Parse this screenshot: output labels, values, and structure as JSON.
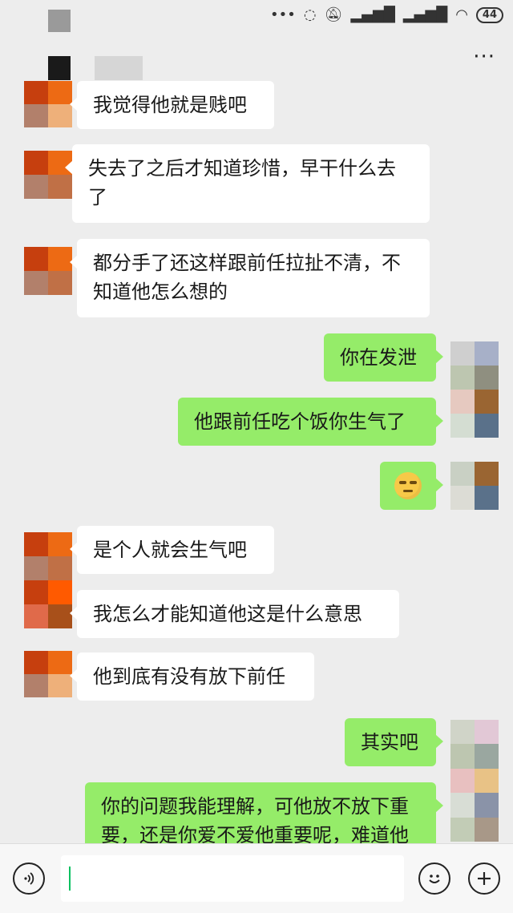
{
  "status_bar": {
    "battery": "44"
  },
  "header": {
    "more": "···"
  },
  "messages": [
    {
      "dir": "in",
      "text": "我觉得他就是贱吧"
    },
    {
      "dir": "in",
      "text": "失去了之后才知道珍惜，早干什么去了"
    },
    {
      "dir": "in",
      "text": "都分手了还这样跟前任拉扯不清，不知道他怎么想的"
    },
    {
      "dir": "out",
      "text": "你在发泄"
    },
    {
      "dir": "out",
      "text": "他跟前任吃个饭你生气了"
    },
    {
      "dir": "out",
      "emoji": "smirk-emoji"
    },
    {
      "dir": "in",
      "text": "是个人就会生气吧"
    },
    {
      "dir": "in",
      "text": "我怎么才能知道他这是什么意思"
    },
    {
      "dir": "in",
      "text": "他到底有没有放下前任"
    },
    {
      "dir": "out",
      "text": "其实吧"
    },
    {
      "dir": "out",
      "text": "你的问题我能理解，可他放不放下重要，还是你爱不爱他重要呢，难道他"
    }
  ],
  "input_bar": {
    "voice_icon": "voice-icon",
    "emoji_icon": "emoji-icon",
    "plus_icon": "plus-icon",
    "value": ""
  }
}
